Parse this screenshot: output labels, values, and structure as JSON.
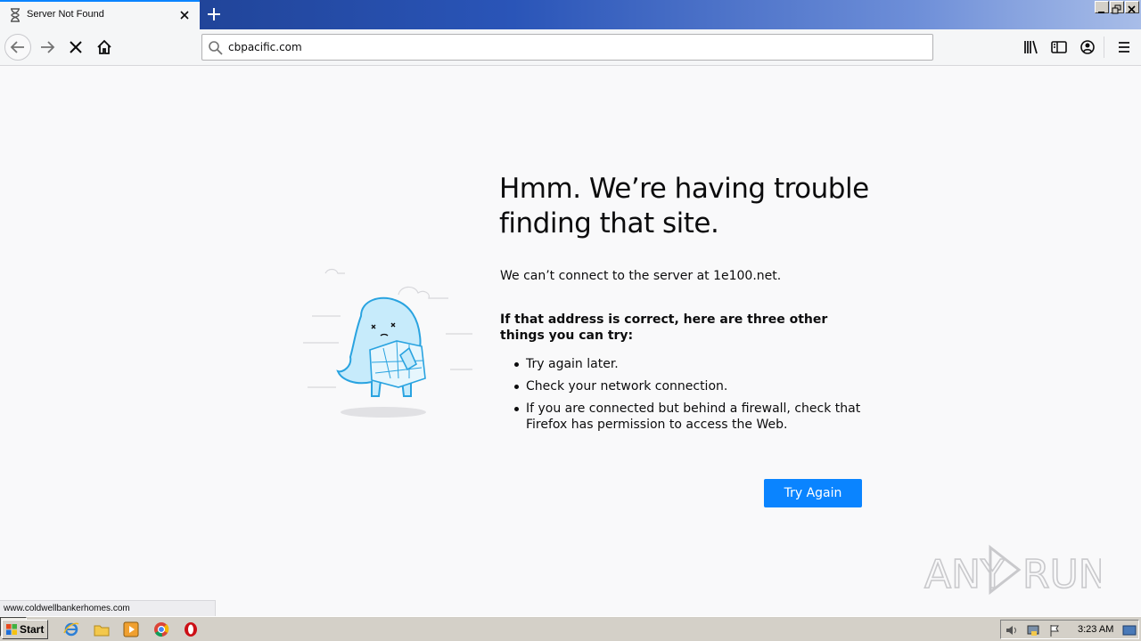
{
  "tab": {
    "title": "Server Not Found"
  },
  "urlbar": {
    "value": "cbpacific.com"
  },
  "error": {
    "title": "Hmm. We’re having trouble finding that site.",
    "description": "We can’t connect to the server at 1e100.net.",
    "suggestion_heading": "If that address is correct, here are three other things you can try:",
    "suggestions": [
      "Try again later.",
      "Check your network connection.",
      "If you are connected but behind a firewall, check that Firefox has permission to access the Web."
    ],
    "try_again_label": "Try Again"
  },
  "status_url": "www.coldwellbankerhomes.com",
  "watermark": "ANY RUN",
  "taskbar": {
    "start_label": "Start",
    "apps": [
      "ie-icon",
      "explorer-icon",
      "media-player-icon",
      "chrome-icon",
      "opera-icon",
      "firefox-icon"
    ],
    "clock": "3:23 AM"
  },
  "colors": {
    "accent": "#0a84ff",
    "titlebar": "#2a55b8",
    "page_bg": "#f9f9fa"
  }
}
